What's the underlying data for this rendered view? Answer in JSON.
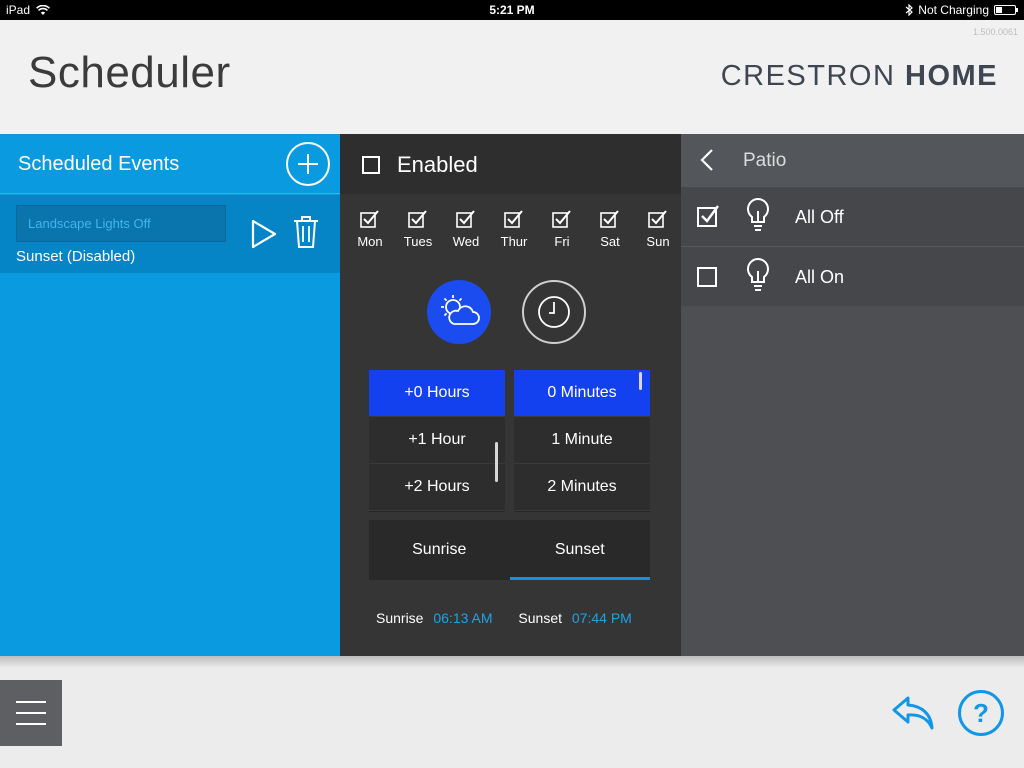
{
  "statusbar": {
    "device": "iPad",
    "time": "5:21 PM",
    "charging": "Not Charging"
  },
  "header": {
    "title": "Scheduler",
    "brand_light": "CRESTRON",
    "brand_bold": "HOME",
    "version": "1.500.0061"
  },
  "left": {
    "title": "Scheduled Events",
    "event": {
      "name": "Landscape Lights Off",
      "subtitle": "Sunset  (Disabled)"
    }
  },
  "middle": {
    "enabled_label": "Enabled",
    "days": [
      {
        "label": "Mon",
        "checked": true
      },
      {
        "label": "Tues",
        "checked": true
      },
      {
        "label": "Wed",
        "checked": true
      },
      {
        "label": "Thur",
        "checked": true
      },
      {
        "label": "Fri",
        "checked": true
      },
      {
        "label": "Sat",
        "checked": true
      },
      {
        "label": "Sun",
        "checked": true
      }
    ],
    "hours": [
      "+0 Hours",
      "+1 Hour",
      "+2 Hours"
    ],
    "minutes": [
      "0 Minutes",
      "1 Minute",
      "2 Minutes"
    ],
    "tabs": [
      "Sunrise",
      "Sunset"
    ],
    "sunrise_label": "Sunrise",
    "sunrise_time": "06:13 AM",
    "sunset_label": "Sunset",
    "sunset_time": "07:44 PM"
  },
  "right": {
    "title": "Patio",
    "scenes": [
      {
        "label": "All Off",
        "checked": true
      },
      {
        "label": "All On",
        "checked": false
      }
    ]
  },
  "colors": {
    "accent_blue": "#0a9ae0",
    "selected_blue": "#1441f0",
    "help_blue": "#1396e6"
  }
}
